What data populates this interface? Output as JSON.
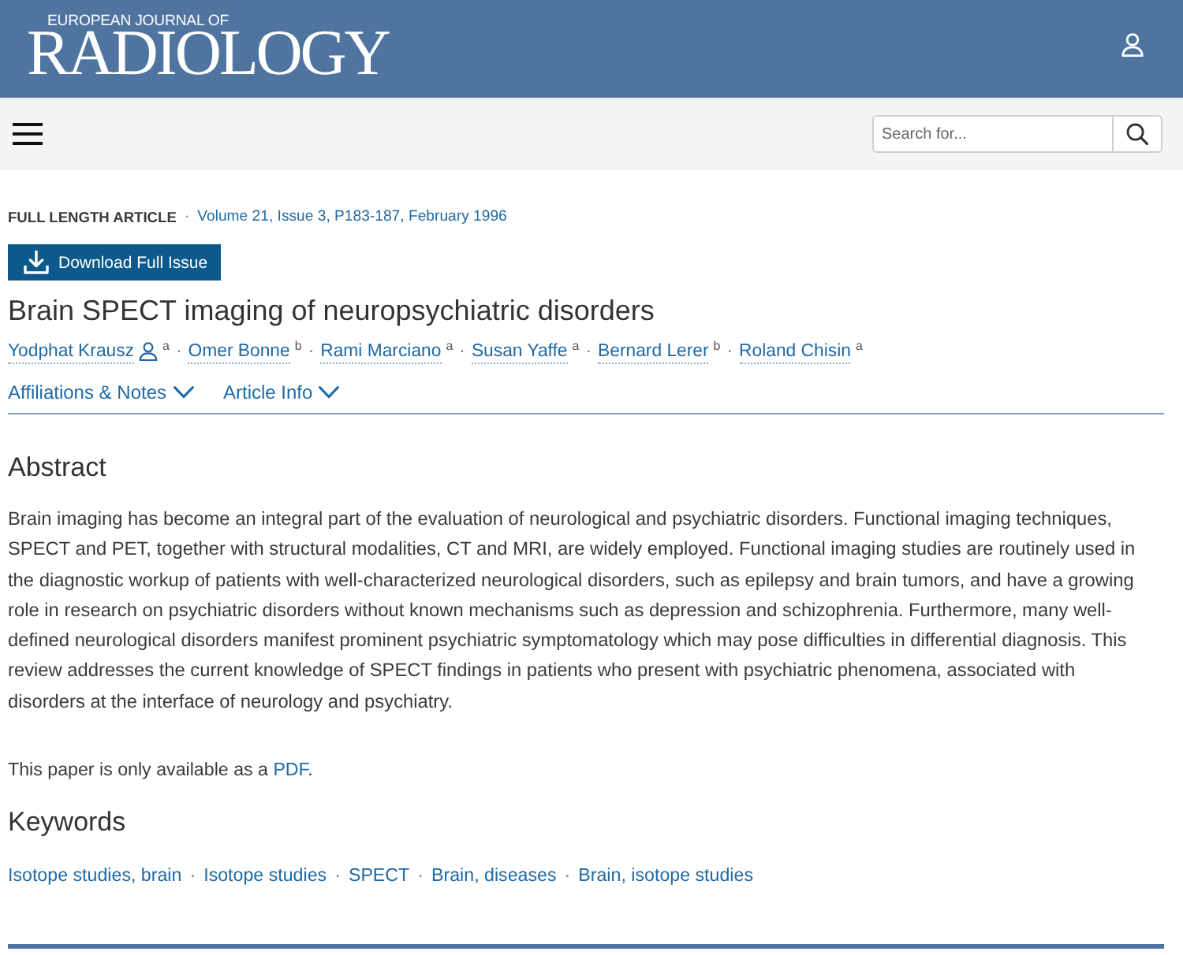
{
  "header": {
    "journal_line": "EUROPEAN JOURNAL OF",
    "journal_name": "RADIOLOGY"
  },
  "toolbar": {
    "search": {
      "placeholder": "Search for..."
    }
  },
  "article": {
    "type": "FULL LENGTH ARTICLE",
    "separator": "·",
    "citation": "Volume 21, Issue 3, P183-187, February 1996",
    "download_button": "Download Full Issue",
    "title": "Brain SPECT imaging of neuropsychiatric disorders",
    "authors": [
      {
        "name": "Yodphat Krausz",
        "corresponding": true,
        "affiliation": "a"
      },
      {
        "name": "Omer Bonne",
        "corresponding": false,
        "affiliation": "b"
      },
      {
        "name": "Rami Marciano",
        "corresponding": false,
        "affiliation": "a"
      },
      {
        "name": "Susan Yaffe",
        "corresponding": false,
        "affiliation": "a"
      },
      {
        "name": "Bernard Lerer",
        "corresponding": false,
        "affiliation": "b"
      },
      {
        "name": "Roland Chisin",
        "corresponding": false,
        "affiliation": "a"
      }
    ],
    "info_toggles": [
      {
        "label": "Affiliations & Notes",
        "expanded": false
      },
      {
        "label": "Article Info",
        "expanded": false
      }
    ]
  },
  "abstract": {
    "heading": "Abstract",
    "text": "Brain imaging has become an integral part of the evaluation of neurological and psychiatric disorders. Functional imaging techniques, SPECT and PET, together with structural modalities, CT and MRI, are widely employed. Functional imaging studies are routinely used in the diagnostic workup of patients with well-characterized neurological disorders, such as epilepsy and brain tumors, and have a growing role in research on psychiatric disorders without known mechanisms such as depression and schizophrenia. Furthermore, many well-defined neurological disorders manifest prominent psychiatric symptomatology which may pose difficulties in differential diagnosis. This review addresses the current knowledge of SPECT findings in patients who present with psychiatric phenomena, associated with disorders at the interface of neurology and psychiatry."
  },
  "availability": {
    "text_before": "This paper is only available as a ",
    "link": "PDF",
    "text_after": "."
  },
  "keywords": {
    "heading": "Keywords",
    "separator": "·",
    "items": [
      "Isotope studies, brain",
      "Isotope studies",
      "SPECT",
      "Brain, diseases",
      "Brain, isotope studies"
    ]
  }
}
